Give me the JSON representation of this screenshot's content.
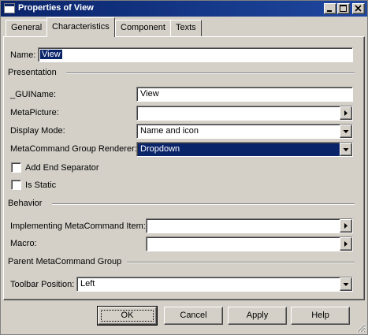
{
  "window": {
    "title": "Properties of View"
  },
  "tabs": [
    {
      "label": "General"
    },
    {
      "label": "Characteristics"
    },
    {
      "label": "Component"
    },
    {
      "label": "Texts"
    }
  ],
  "active_tab": "Characteristics",
  "name": {
    "label": "Name:",
    "value": "View"
  },
  "presentation": {
    "header": "Presentation",
    "guiname": {
      "label": "_GUIName:",
      "value": "View"
    },
    "metapicture": {
      "label": "MetaPicture:",
      "value": ""
    },
    "display_mode": {
      "label": "Display Mode:",
      "value": "Name and icon"
    },
    "renderer": {
      "label": "MetaCommand Group Renderer:",
      "value": "Dropdown"
    },
    "add_end_separator": {
      "label": "Add End Separator",
      "checked": false
    },
    "is_static": {
      "label": "Is Static",
      "checked": false
    }
  },
  "behavior": {
    "header": "Behavior",
    "implementing_item": {
      "label": "Implementing MetaCommand Item:",
      "value": ""
    },
    "macro": {
      "label": "Macro:",
      "value": ""
    }
  },
  "parent_group": {
    "header": "Parent MetaCommand Group",
    "toolbar_position": {
      "label": "Toolbar Position:",
      "value": "Left"
    }
  },
  "buttons": {
    "ok": "OK",
    "cancel": "Cancel",
    "apply": "Apply",
    "help": "Help"
  },
  "colors": {
    "titlebar": "#0a246a",
    "face": "#d4d0c8",
    "selection": "#0a246a"
  },
  "icons": {
    "app": "window-icon",
    "minimize": "minimize-icon",
    "maximize": "maximize-icon",
    "close": "close-icon",
    "dropdown": "chevron-down-icon",
    "browse": "triangle-right-icon"
  }
}
